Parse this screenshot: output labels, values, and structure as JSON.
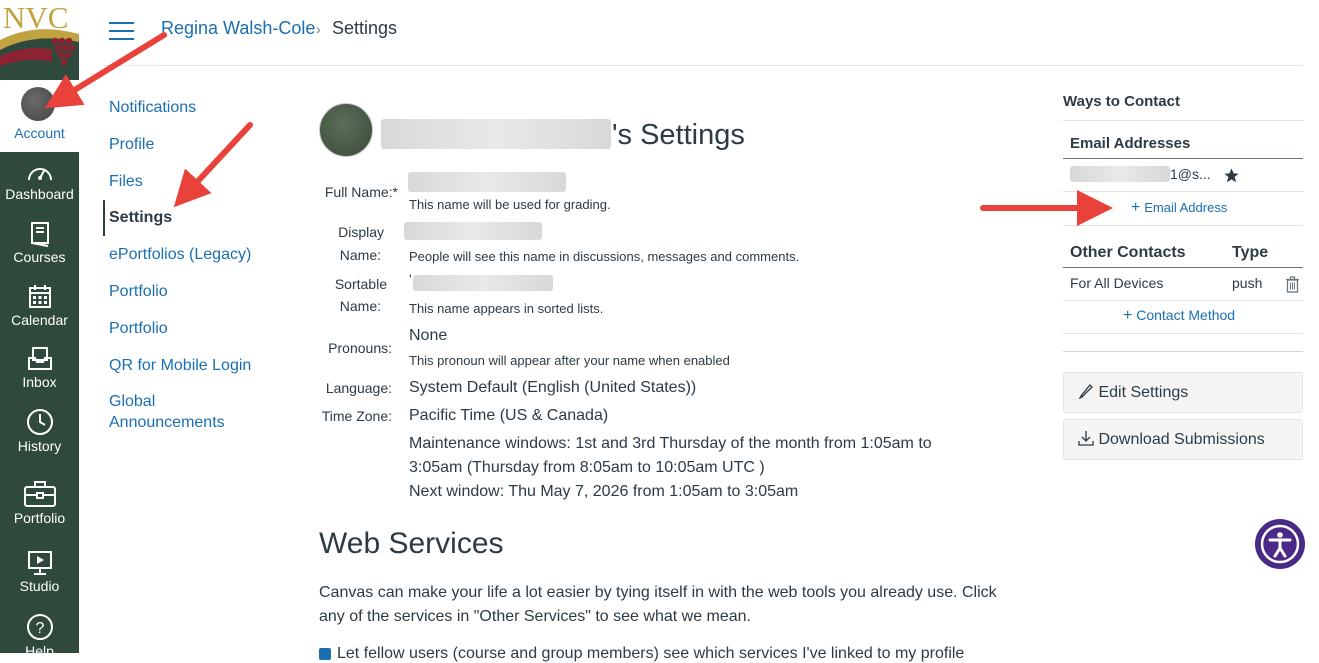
{
  "logo": {
    "text": "NVC"
  },
  "global_nav": {
    "account_label": "Account",
    "items": [
      {
        "label": "Dashboard",
        "icon": "dashboard-icon"
      },
      {
        "label": "Courses",
        "icon": "courses-icon"
      },
      {
        "label": "Calendar",
        "icon": "calendar-icon"
      },
      {
        "label": "Inbox",
        "icon": "inbox-icon"
      },
      {
        "label": "History",
        "icon": "history-icon"
      },
      {
        "label": "Portfolio",
        "icon": "portfolio-icon"
      },
      {
        "label": "Studio",
        "icon": "studio-icon"
      },
      {
        "label": "Help",
        "icon": "help-icon"
      }
    ],
    "bg_color": "#2f4a3c"
  },
  "breadcrumb": {
    "user": "Regina Walsh-Cole",
    "separator": "›",
    "current": "Settings"
  },
  "sub_nav": {
    "items": [
      "Notifications",
      "Profile",
      "Files",
      "Settings",
      "ePortfolios (Legacy)",
      "Portfolio",
      "Portfolio",
      "QR for Mobile Login",
      "Global Announcements"
    ],
    "active": "Settings"
  },
  "profile": {
    "title_suffix": "'s Settings",
    "full_name_label": "Full Name:*",
    "full_name_hint": "This name will be used for grading.",
    "display_name_label_1": "Display",
    "display_name_label_2": "Name:",
    "display_name_hint": "People will see this name in discussions, messages and comments.",
    "sortable_name_label_1": "Sortable",
    "sortable_name_label_2": "Name:",
    "sortable_name_prefix": "'",
    "sortable_name_hint": "This name appears in sorted lists.",
    "pronouns_label": "Pronouns:",
    "pronouns_value": "None",
    "pronouns_hint": "This pronoun will appear after your name when enabled",
    "language_label": "Language:",
    "language_value": "System Default (English (United States))",
    "timezone_label": "Time Zone:",
    "timezone_value": "Pacific Time (US & Canada)",
    "maintenance_line_1": "Maintenance windows: 1st and 3rd Thursday of the month from 1:05am to",
    "maintenance_line_2": "3:05am (Thursday from 8:05am to 10:05am UTC )",
    "next_window": "Next window: Thu May 7, 2026 from 1:05am to 3:05am"
  },
  "web_services": {
    "title": "Web Services",
    "text": "Canvas can make your life a lot easier by tying itself in with the web tools you already use. Click any of the services in \"Other Services\" to see what we mean.",
    "checkbox_text": "Let fellow users (course and group members) see which services I've linked to my profile"
  },
  "contact": {
    "heading": "Ways to Contact",
    "email_heading": "Email Addresses",
    "email_value": "1@s...",
    "add_email": "Email Address",
    "other_heading": "Other Contacts",
    "type_heading": "Type",
    "other_name": "For All Devices",
    "other_type": "push",
    "add_contact": "Contact Method"
  },
  "actions": {
    "edit_settings": "Edit Settings",
    "download_submissions": "Download Submissions"
  },
  "colors": {
    "link": "#1a6fb3",
    "text": "#2d3b45",
    "arrow": "#e8423b",
    "a11y": "#4b2a87"
  }
}
